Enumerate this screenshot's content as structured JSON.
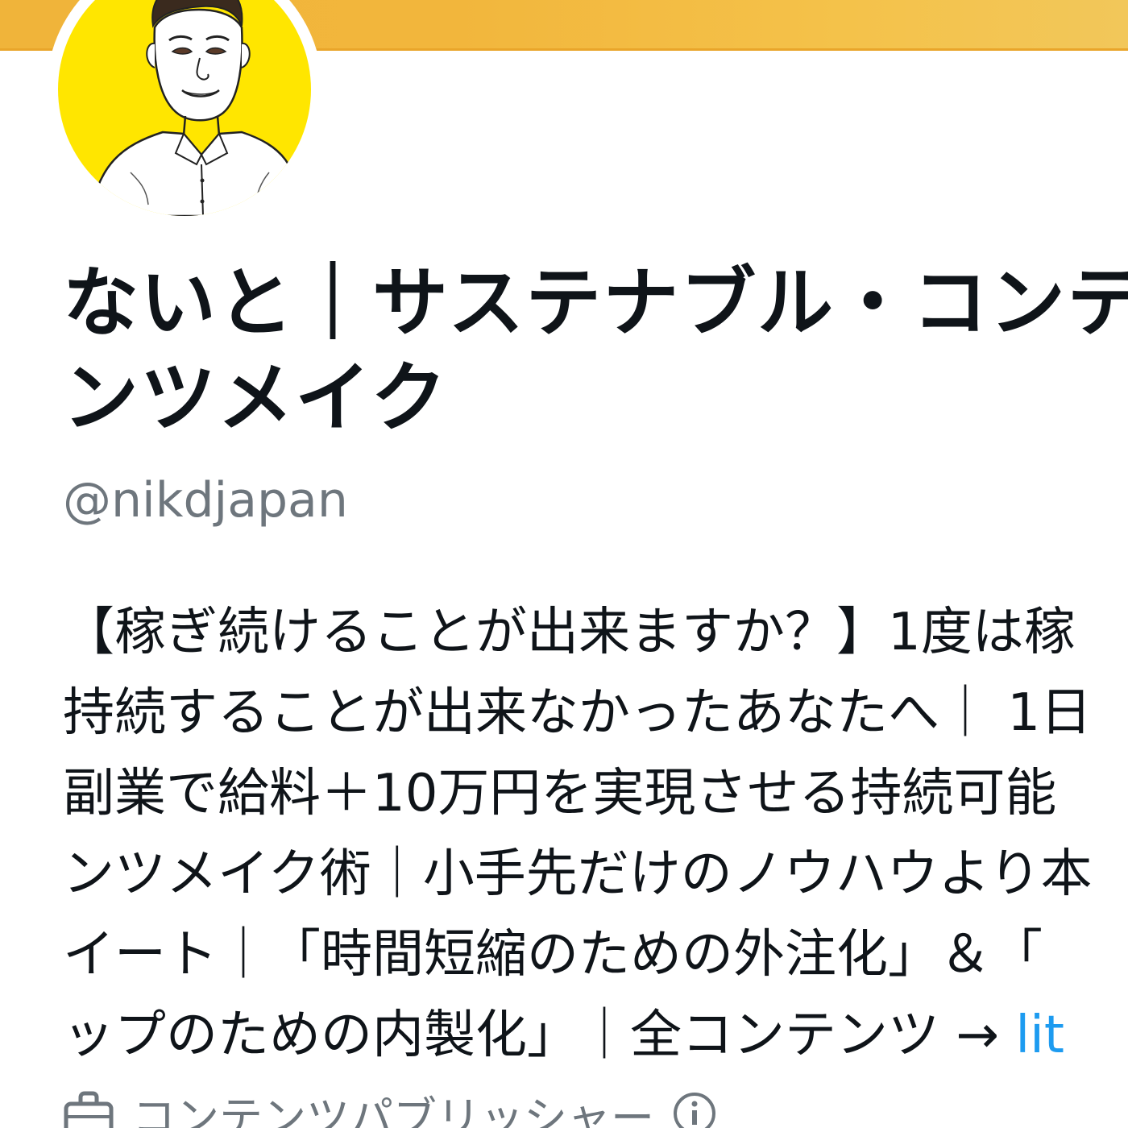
{
  "profile": {
    "display_name_line1": "ないと｜サステナブル・コンテ",
    "display_name_line2": "ンツメイク",
    "handle": "@nikdjapan",
    "bio_lines": [
      "【稼ぎ続けることが出来ますか？】1度は稼",
      "持続することが出来なかったあなたへ｜ 1日",
      "副業で給料＋10万円を実現させる持続可能",
      "ンツメイク術｜小手先だけのノウハウより本",
      "イート｜「時間短縮のための外注化」＆「",
      "ップのための内製化」｜全コンテンツ → "
    ],
    "bio_link": "lit",
    "category_label": "コンテンツパブリッシャー",
    "avatar_icon": "avatar-illustration",
    "category_icon": "briefcase-icon",
    "info_icon": "info-icon"
  },
  "colors": {
    "banner": "#f0b43a",
    "avatar_bg": "#ffe600",
    "handle": "#6e767d",
    "link": "#1d9bf0",
    "text": "#0f1419"
  }
}
